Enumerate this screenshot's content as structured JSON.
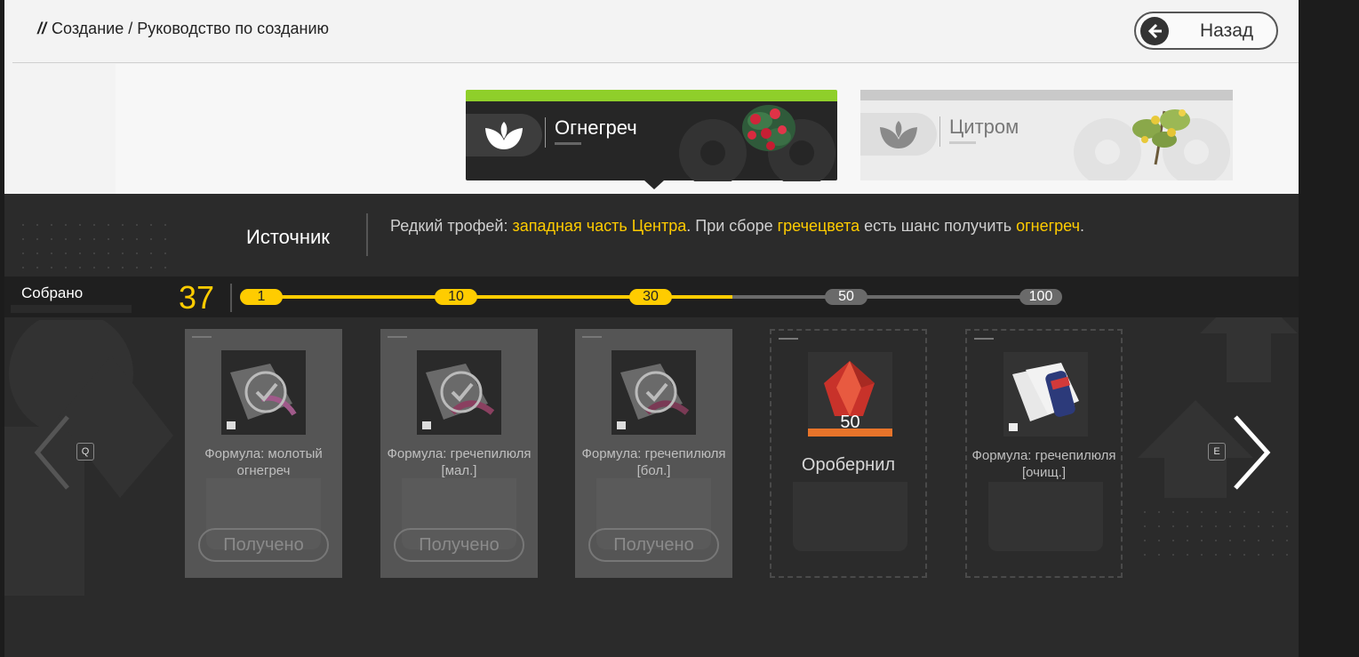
{
  "header": {
    "breadcrumb_section": "Создание",
    "breadcrumb_page": "Руководство по созданию",
    "back_label": "Назад"
  },
  "materials": [
    {
      "name": "Огнегреч",
      "active": true,
      "accent": "#8fcf2a"
    },
    {
      "name": "Цитром",
      "active": false
    }
  ],
  "source": {
    "label": "Источник",
    "text_1": "Редкий трофей: ",
    "hl_1": "западная часть Центра",
    "text_2": ". При сборе ",
    "hl_2": "гречецвета",
    "text_3": " есть шанс получить ",
    "hl_3": "огнегреч",
    "text_4": "."
  },
  "progress": {
    "label": "Собрано",
    "count": "37",
    "milestones": [
      {
        "value": "1",
        "reached": true
      },
      {
        "value": "10",
        "reached": true
      },
      {
        "value": "30",
        "reached": true
      },
      {
        "value": "50",
        "reached": false
      },
      {
        "value": "100",
        "reached": false
      }
    ],
    "fill_fraction": 0.6,
    "highlight_color": "#ffcc00"
  },
  "rewards": [
    {
      "title": "Формула: молотый огнегреч",
      "status": "Получено",
      "claimed": true
    },
    {
      "title": "Формула: гречепилюля [мал.]",
      "status": "Получено",
      "claimed": true
    },
    {
      "title": "Формула: гречепилюля [бол.]",
      "status": "Получено",
      "claimed": true
    },
    {
      "title": "Оробернил",
      "amount": "50",
      "claimed": false
    },
    {
      "title": "Формула: гречепилюля [очищ.]",
      "claimed": false
    }
  ],
  "nav": {
    "prev_key": "Q",
    "next_key": "E"
  }
}
